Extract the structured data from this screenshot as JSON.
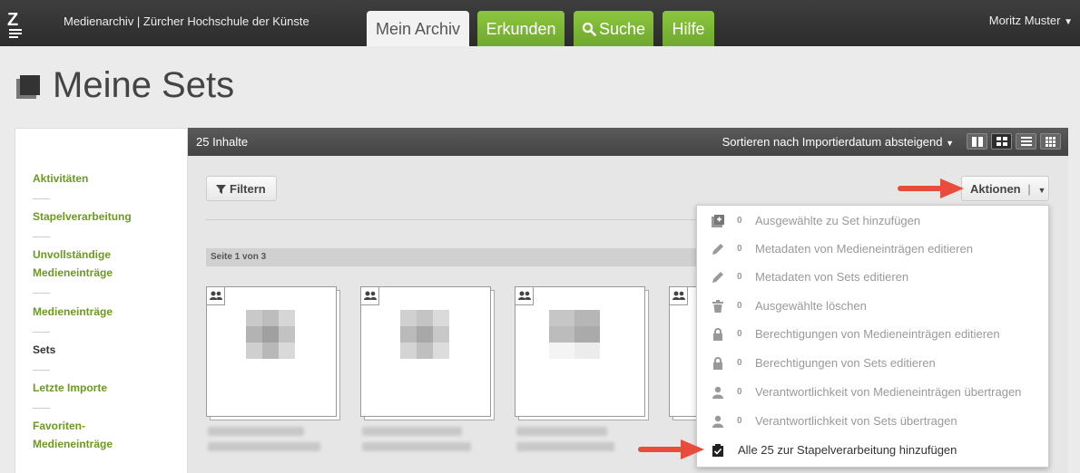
{
  "header": {
    "logo_text": "Z",
    "app_title": "Medienarchiv | Zürcher Hochschule der Künste",
    "tabs": [
      {
        "label": "Mein Archiv",
        "active": true
      },
      {
        "label": "Erkunden",
        "active": false
      },
      {
        "label": "Suche",
        "active": false,
        "icon": "search-icon"
      },
      {
        "label": "Hilfe",
        "active": false
      }
    ],
    "user": "Moritz Muster"
  },
  "page": {
    "title": "Meine Sets"
  },
  "sidebar": {
    "items": [
      {
        "label": "Aktivitäten",
        "active": false
      },
      {
        "label": "Stapelverarbeitung",
        "active": false
      },
      {
        "label": "Unvollständige Medieneinträge",
        "active": false
      },
      {
        "label": "Medieneinträge",
        "active": false
      },
      {
        "label": "Sets",
        "active": true
      },
      {
        "label": "Letzte Importe",
        "active": false
      },
      {
        "label": "Favoriten-Medieneinträge",
        "active": false
      }
    ]
  },
  "main": {
    "count": "25 Inhalte",
    "sort": "Sortieren nach Importierdatum absteigend",
    "view_modes": [
      "columns-view",
      "grid-view",
      "list-view",
      "tiles-view"
    ],
    "active_view": "grid-view",
    "filter_label": "Filtern",
    "aktionen_label": "Aktionen",
    "page_indicator": "Seite 1 von 3"
  },
  "actions_menu": {
    "items": [
      {
        "count": "0",
        "label": "Ausgewählte zu Set hinzufügen",
        "icon": "add-to-set-icon",
        "enabled": false
      },
      {
        "count": "0",
        "label": "Metadaten von Medieneinträgen editieren",
        "icon": "pencil-icon",
        "enabled": false
      },
      {
        "count": "0",
        "label": "Metadaten von Sets editieren",
        "icon": "pencil-icon",
        "enabled": false
      },
      {
        "count": "0",
        "label": "Ausgewählte löschen",
        "icon": "trash-icon",
        "enabled": false
      },
      {
        "count": "0",
        "label": "Berechtigungen von Medieneinträgen editieren",
        "icon": "lock-icon",
        "enabled": false
      },
      {
        "count": "0",
        "label": "Berechtigungen von Sets editieren",
        "icon": "lock-icon",
        "enabled": false
      },
      {
        "count": "0",
        "label": "Verantwortlichkeit von Medieneinträgen übertragen",
        "icon": "user-icon",
        "enabled": false
      },
      {
        "count": "0",
        "label": "Verantwortlichkeit von Sets übertragen",
        "icon": "user-icon",
        "enabled": false
      },
      {
        "count": "",
        "label": "Alle 25 zur Stapelverarbeitung hinzufügen",
        "icon": "clipboard-check-icon",
        "enabled": true
      }
    ]
  },
  "colors": {
    "accent_green": "#7ab535",
    "sidebar_link": "#6b9a1f",
    "annotation_arrow": "#e84c3d"
  }
}
